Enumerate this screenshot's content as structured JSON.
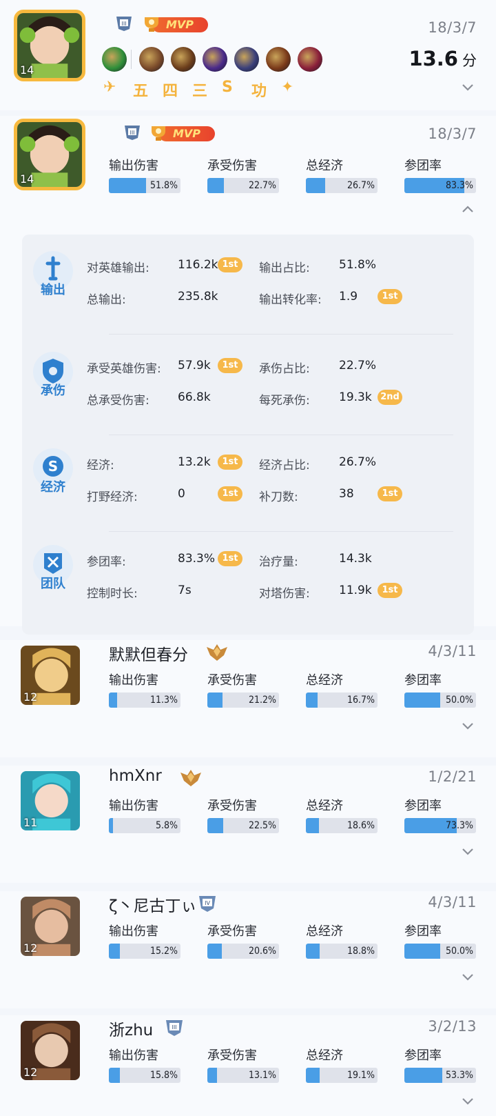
{
  "match": {
    "level": "14",
    "rank_badge": "III",
    "mvp_label": "MVP",
    "kda": "18/3/7",
    "score": "13.6",
    "score_unit": "分",
    "equipment_icons": [
      "skill-icon",
      "boots-icon",
      "axe-icon",
      "blade-icon",
      "star-blade-icon",
      "spear-icon",
      "crimson-blade-icon"
    ],
    "rune_glyphs": [
      "✈",
      "五",
      "四",
      "三",
      "S",
      "功",
      "✦"
    ]
  },
  "stat_labels": [
    "输出伤害",
    "承受伤害",
    "总经济",
    "参团率"
  ],
  "expanded": {
    "level": "14",
    "rank_badge": "III",
    "mvp_label": "MVP",
    "kda": "18/3/7",
    "stats": [
      {
        "value": "51.8%",
        "pct": 51.8
      },
      {
        "value": "22.7%",
        "pct": 22.7
      },
      {
        "value": "26.7%",
        "pct": 26.7
      },
      {
        "value": "83.3%",
        "pct": 83.3
      }
    ]
  },
  "detail": {
    "blocks": [
      {
        "category": "输出",
        "icon": "sword-icon",
        "rows": [
          {
            "l1": "对英雄输出:",
            "v1": "116.2k",
            "t1": "1st",
            "l2": "输出占比:",
            "v2": "51.8%",
            "t2": ""
          },
          {
            "l1": "总输出:",
            "v1": "235.8k",
            "t1": "",
            "l2": "输出转化率:",
            "v2": "1.9",
            "t2": "1st"
          }
        ]
      },
      {
        "category": "承伤",
        "icon": "shield-icon",
        "rows": [
          {
            "l1": "承受英雄伤害:",
            "v1": "57.9k",
            "t1": "1st",
            "l2": "承伤占比:",
            "v2": "22.7%",
            "t2": ""
          },
          {
            "l1": "总承受伤害:",
            "v1": "66.8k",
            "t1": "",
            "l2": "每死承伤:",
            "v2": "19.3k",
            "t2": "2nd"
          }
        ]
      },
      {
        "category": "经济",
        "icon": "gold-coin-icon",
        "rows": [
          {
            "l1": "经济:",
            "v1": "13.2k",
            "t1": "1st",
            "l2": "经济占比:",
            "v2": "26.7%",
            "t2": ""
          },
          {
            "l1": "打野经济:",
            "v1": "0",
            "t1": "1st",
            "l2": "补刀数:",
            "v2": "38",
            "t2": "1st"
          }
        ]
      },
      {
        "category": "团队",
        "icon": "team-flag-icon",
        "rows": [
          {
            "l1": "参团率:",
            "v1": "83.3%",
            "t1": "1st",
            "l2": "治疗量:",
            "v2": "14.3k",
            "t2": ""
          },
          {
            "l1": "控制时长:",
            "v1": "7s",
            "t1": "",
            "l2": "对塔伤害:",
            "v2": "11.9k",
            "t2": "1st"
          }
        ]
      }
    ]
  },
  "players": [
    {
      "name": "默默但春分",
      "level": "12",
      "kda": "4/3/11",
      "rank": "gold-wings",
      "stats": [
        {
          "value": "11.3%",
          "pct": 11.3
        },
        {
          "value": "21.2%",
          "pct": 21.2
        },
        {
          "value": "16.7%",
          "pct": 16.7
        },
        {
          "value": "50.0%",
          "pct": 50.0
        }
      ]
    },
    {
      "name": "hmXnr",
      "level": "11",
      "kda": "1/2/21",
      "rank": "gold-wings",
      "stats": [
        {
          "value": "5.8%",
          "pct": 5.8
        },
        {
          "value": "22.5%",
          "pct": 22.5
        },
        {
          "value": "18.6%",
          "pct": 18.6
        },
        {
          "value": "73.3%",
          "pct": 73.3
        }
      ]
    },
    {
      "name": "ζ丶尼古丁ぃ",
      "level": "12",
      "kda": "4/3/11",
      "rank": "IV",
      "stats": [
        {
          "value": "15.2%",
          "pct": 15.2
        },
        {
          "value": "20.6%",
          "pct": 20.6
        },
        {
          "value": "18.8%",
          "pct": 18.8
        },
        {
          "value": "50.0%",
          "pct": 50.0
        }
      ]
    },
    {
      "name": "浙zhu",
      "level": "12",
      "kda": "3/2/13",
      "rank": "III",
      "stats": [
        {
          "value": "15.8%",
          "pct": 15.8
        },
        {
          "value": "13.1%",
          "pct": 13.1
        },
        {
          "value": "19.1%",
          "pct": 19.1
        },
        {
          "value": "53.3%",
          "pct": 53.3
        }
      ]
    }
  ],
  "colors": {
    "bar_fill": "#4a9ee6",
    "bar_bg": "#dfe2ea",
    "accent_gold": "#f7b93e",
    "mvp_red": "#e8432d",
    "category_blue": "#2f80ce"
  }
}
